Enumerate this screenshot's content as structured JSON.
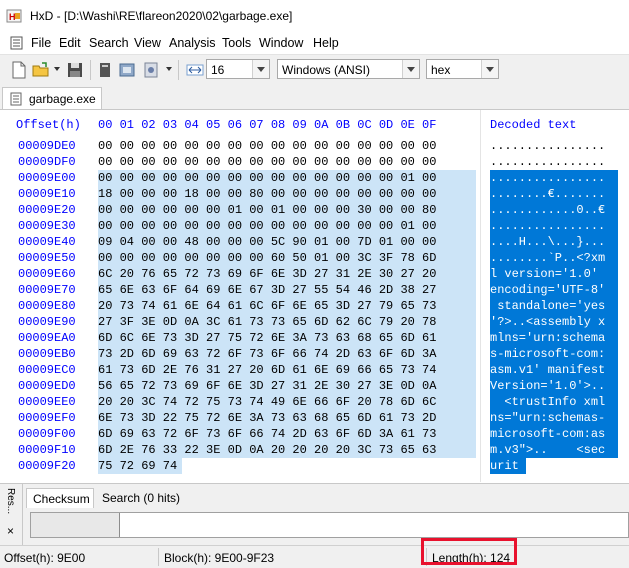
{
  "window": {
    "title": "HxD - [D:\\Washi\\RE\\flareon2020\\02\\garbage.exe]"
  },
  "menu": [
    "File",
    "Edit",
    "Search",
    "View",
    "Analysis",
    "Tools",
    "Window",
    "Help"
  ],
  "toolbar": {
    "bytes_per_row": "16",
    "charset": "Windows (ANSI)",
    "offset_base": "hex"
  },
  "tab": {
    "label": "garbage.exe"
  },
  "hexview": {
    "offset_header": "Offset(h)",
    "column_header": "00 01 02 03 04 05 06 07 08 09 0A 0B 0C 0D 0E 0F",
    "decoded_header": "Decoded text",
    "rows": [
      {
        "offset": "00009DE0",
        "hex": "00 00 00 00 00 00 00 00 00 00 00 00 00 00 00 00",
        "text": "................",
        "selected": false
      },
      {
        "offset": "00009DF0",
        "hex": "00 00 00 00 00 00 00 00 00 00 00 00 00 00 00 00",
        "text": "................",
        "selected": false
      },
      {
        "offset": "00009E00",
        "hex": "00 00 00 00 00 00 00 00 00 00 00 00 00 00 01 00",
        "text": "................",
        "selected": true
      },
      {
        "offset": "00009E10",
        "hex": "18 00 00 00 18 00 00 80 00 00 00 00 00 00 00 00",
        "text": "........€.......",
        "selected": true
      },
      {
        "offset": "00009E20",
        "hex": "00 00 00 00 00 00 01 00 01 00 00 00 30 00 00 80",
        "text": "............0..€",
        "selected": true
      },
      {
        "offset": "00009E30",
        "hex": "00 00 00 00 00 00 00 00 00 00 00 00 00 00 01 00",
        "text": "................",
        "selected": true
      },
      {
        "offset": "00009E40",
        "hex": "09 04 00 00 48 00 00 00 5C 90 01 00 7D 01 00 00",
        "text": "....H...\\...}...",
        "selected": true
      },
      {
        "offset": "00009E50",
        "hex": "00 00 00 00 00 00 00 00 60 50 01 00 3C 3F 78 6D",
        "text": "........`P..<?xm",
        "selected": true
      },
      {
        "offset": "00009E60",
        "hex": "6C 20 76 65 72 73 69 6F 6E 3D 27 31 2E 30 27 20",
        "text": "l version='1.0' ",
        "selected": true
      },
      {
        "offset": "00009E70",
        "hex": "65 6E 63 6F 64 69 6E 67 3D 27 55 54 46 2D 38 27",
        "text": "encoding='UTF-8'",
        "selected": true
      },
      {
        "offset": "00009E80",
        "hex": "20 73 74 61 6E 64 61 6C 6F 6E 65 3D 27 79 65 73",
        "text": " standalone='yes",
        "selected": true
      },
      {
        "offset": "00009E90",
        "hex": "27 3F 3E 0D 0A 3C 61 73 73 65 6D 62 6C 79 20 78",
        "text": "'?>..<assembly x",
        "selected": true
      },
      {
        "offset": "00009EA0",
        "hex": "6D 6C 6E 73 3D 27 75 72 6E 3A 73 63 68 65 6D 61",
        "text": "mlns='urn:schema",
        "selected": true
      },
      {
        "offset": "00009EB0",
        "hex": "73 2D 6D 69 63 72 6F 73 6F 66 74 2D 63 6F 6D 3A",
        "text": "s-microsoft-com:",
        "selected": true
      },
      {
        "offset": "00009EC0",
        "hex": "61 73 6D 2E 76 31 27 20 6D 61 6E 69 66 65 73 74",
        "text": "asm.v1' manifest",
        "selected": true
      },
      {
        "offset": "00009ED0",
        "hex": "56 65 72 73 69 6F 6E 3D 27 31 2E 30 27 3E 0D 0A",
        "text": "Version='1.0'>..",
        "selected": true
      },
      {
        "offset": "00009EE0",
        "hex": "20 20 3C 74 72 75 73 74 49 6E 66 6F 20 78 6D 6C",
        "text": "  <trustInfo xml",
        "selected": true
      },
      {
        "offset": "00009EF0",
        "hex": "6E 73 3D 22 75 72 6E 3A 73 63 68 65 6D 61 73 2D",
        "text": "ns=\"urn:schemas-",
        "selected": true
      },
      {
        "offset": "00009F00",
        "hex": "6D 69 63 72 6F 73 6F 66 74 2D 63 6F 6D 3A 61 73",
        "text": "microsoft-com:as",
        "selected": true
      },
      {
        "offset": "00009F10",
        "hex": "6D 2E 76 33 22 3E 0D 0A 20 20 20 20 3C 73 65 63",
        "text": "m.v3\">..    <sec",
        "selected": true
      },
      {
        "offset": "00009F20",
        "hex": "75 72 69 74",
        "text": "urit",
        "selected": true
      }
    ]
  },
  "bottom_panel": {
    "side_label": "Res...",
    "close_glyph": "×",
    "tabs": [
      "Checksum",
      "Search (0 hits)"
    ]
  },
  "status": {
    "offset": "Offset(h): 9E00",
    "block": "Block(h): 9E00-9F23",
    "length": "Length(h): 124"
  },
  "colors": {
    "selection_hex": "#cce4f7",
    "selection_text": "#0078d7",
    "offset_blue": "#0000ff",
    "highlight_red": "#e8112d"
  }
}
